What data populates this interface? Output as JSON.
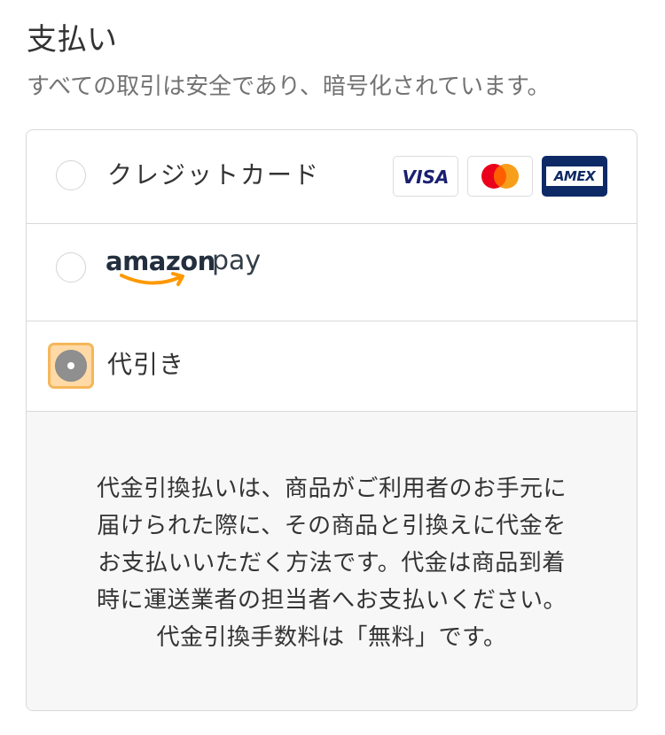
{
  "header": {
    "title": "支払い",
    "subtitle": "すべての取引は安全であり、暗号化されています。"
  },
  "payment_options": {
    "credit_card": {
      "label": "クレジットカード",
      "selected": false,
      "brands": [
        {
          "name": "visa-icon",
          "text": "VISA",
          "color": "#1a1f71"
        },
        {
          "name": "mastercard-icon",
          "colors": [
            "#eb001b",
            "#f79e1b",
            "#ff5f00"
          ]
        },
        {
          "name": "amex-icon",
          "text": "AMEX",
          "color": "#0e2a66"
        }
      ]
    },
    "amazon_pay": {
      "logo_word_1": "amazon",
      "logo_word_2": "pay",
      "logo_color": "#232f3e",
      "smile_color": "#ff9900",
      "selected": false
    },
    "cod": {
      "label": "代引き",
      "selected": true,
      "focus_color": "#f5b75a"
    }
  },
  "cod_details": {
    "lines": [
      "代金引換払いは、商品がご利用者のお手元に",
      "届けられた際に、その商品と引換えに代金を",
      "お支払いいただく方法です。代金は商品到着",
      "時に運送業者の担当者へお支払いください。",
      "代金引換手数料は「無料」です。"
    ]
  }
}
